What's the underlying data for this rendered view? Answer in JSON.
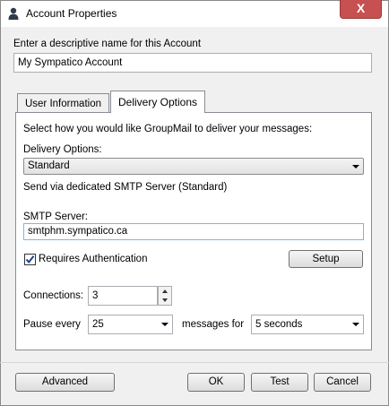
{
  "window": {
    "title": "Account Properties",
    "close_glyph": "X",
    "title_icon": "user-icon"
  },
  "account": {
    "name_label": "Enter a descriptive name for this Account",
    "name_value": "My Sympatico Account"
  },
  "tabs": [
    {
      "label": "User Information",
      "active": false
    },
    {
      "label": "Delivery Options",
      "active": true
    }
  ],
  "delivery": {
    "intro": "Select how you would like GroupMail to deliver your messages:",
    "options_label": "Delivery Options:",
    "options_value": "Standard",
    "description": "Send via dedicated SMTP Server (Standard)",
    "smtp_label": "SMTP Server:",
    "smtp_value": "smtphm.sympatico.ca",
    "auth_label": "Requires Authentication",
    "auth_checked": true,
    "setup_label": "Setup",
    "connections_label": "Connections:",
    "connections_value": "3",
    "pause_label": "Pause every",
    "pause_value": "25",
    "messages_for_label": "messages for",
    "duration_value": "5 seconds"
  },
  "footer": {
    "advanced_label": "Advanced",
    "ok_label": "OK",
    "test_label": "Test",
    "cancel_label": "Cancel"
  }
}
